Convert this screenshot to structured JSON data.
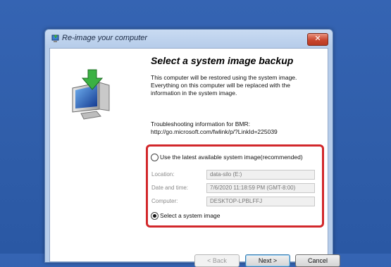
{
  "window": {
    "title": "Re-image your computer",
    "close_label": "✕"
  },
  "content": {
    "heading": "Select a system image backup",
    "description": "This computer will be restored using the system image. Everything on this computer will be replaced with the information in the system image.",
    "troubleshooting_label": "Troubleshooting information for BMR:",
    "troubleshooting_link": "http://go.microsoft.com/fwlink/p/?LinkId=225039"
  },
  "options": {
    "latest_label": "Use the latest available system image(recommended)",
    "latest_selected": false,
    "select_label": "Select a system image",
    "select_selected": true
  },
  "fields": [
    {
      "label": "Location:",
      "value": "data-silo (E:)"
    },
    {
      "label": "Date and time:",
      "value": "7/6/2020 11:18:59 PM (GMT-8:00)"
    },
    {
      "label": "Computer:",
      "value": "DESKTOP-LPBLFFJ"
    }
  ],
  "buttons": {
    "back": "< Back",
    "next": "Next >",
    "cancel": "Cancel"
  },
  "colors": {
    "highlight": "#d2282b",
    "desktop": "#2f5da9"
  },
  "icons": [
    "restore-computer-icon",
    "window-app-icon",
    "close-icon"
  ]
}
